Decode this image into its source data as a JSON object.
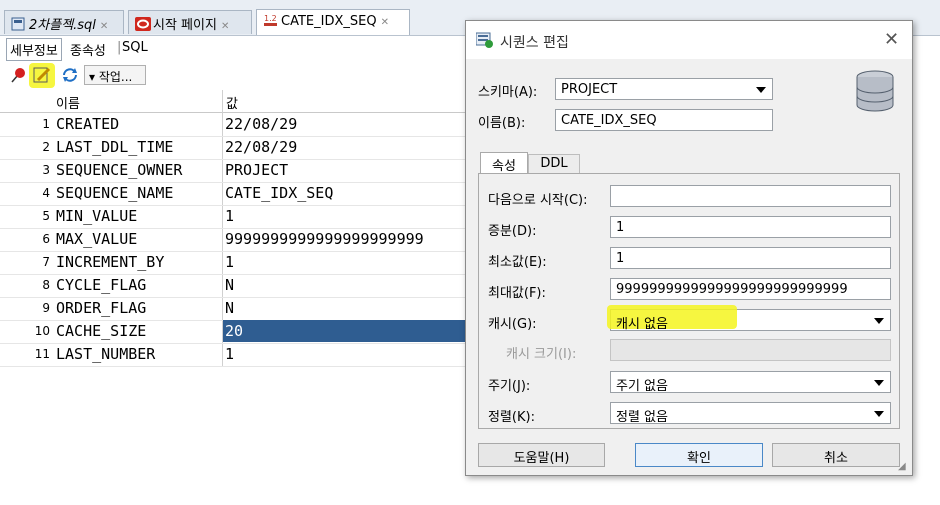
{
  "tabs": [
    {
      "label": "2차플젝.sql",
      "icon": "sql-file-icon"
    },
    {
      "label": "시작 페이지",
      "icon": "oracle-icon"
    },
    {
      "label": "CATE_IDX_SEQ",
      "icon": "sequence-icon"
    }
  ],
  "subtabs": [
    "세부정보",
    "종속성",
    "SQL"
  ],
  "toolbar": {
    "actions_label": "▾ 작업..."
  },
  "grid": {
    "headers": [
      "이름",
      "값"
    ],
    "rows": [
      {
        "num": "1",
        "name": "CREATED",
        "value": "22/08/29"
      },
      {
        "num": "2",
        "name": "LAST_DDL_TIME",
        "value": "22/08/29"
      },
      {
        "num": "3",
        "name": "SEQUENCE_OWNER",
        "value": "PROJECT"
      },
      {
        "num": "4",
        "name": "SEQUENCE_NAME",
        "value": "CATE_IDX_SEQ"
      },
      {
        "num": "5",
        "name": "MIN_VALUE",
        "value": "1"
      },
      {
        "num": "6",
        "name": "MAX_VALUE",
        "value": "9999999999999999999999"
      },
      {
        "num": "7",
        "name": "INCREMENT_BY",
        "value": "1"
      },
      {
        "num": "8",
        "name": "CYCLE_FLAG",
        "value": "N"
      },
      {
        "num": "9",
        "name": "ORDER_FLAG",
        "value": "N"
      },
      {
        "num": "10",
        "name": "CACHE_SIZE",
        "value": "20"
      },
      {
        "num": "11",
        "name": "LAST_NUMBER",
        "value": "1"
      }
    ]
  },
  "dialog": {
    "title": "시퀀스 편집",
    "schema_label": "스키마(A):",
    "schema_value": "PROJECT",
    "name_label": "이름(B):",
    "name_value": "CATE_IDX_SEQ",
    "tabs": [
      "속성",
      "DDL"
    ],
    "start_label": "다음으로 시작(C):",
    "start_value": "",
    "increment_label": "증분(D):",
    "increment_value": "1",
    "min_label": "최소값(E):",
    "min_value": "1",
    "max_label": "최대값(F):",
    "max_value": "9999999999999999999999999999",
    "cache_label": "캐시(G):",
    "cache_value": "캐시 없음",
    "cache_size_label": "캐시 크기(I):",
    "cycle_label": "주기(J):",
    "cycle_value": "주기 없음",
    "order_label": "정렬(K):",
    "order_value": "정렬 없음",
    "help_button": "도움말(H)",
    "ok_button": "확인",
    "cancel_button": "취소"
  }
}
